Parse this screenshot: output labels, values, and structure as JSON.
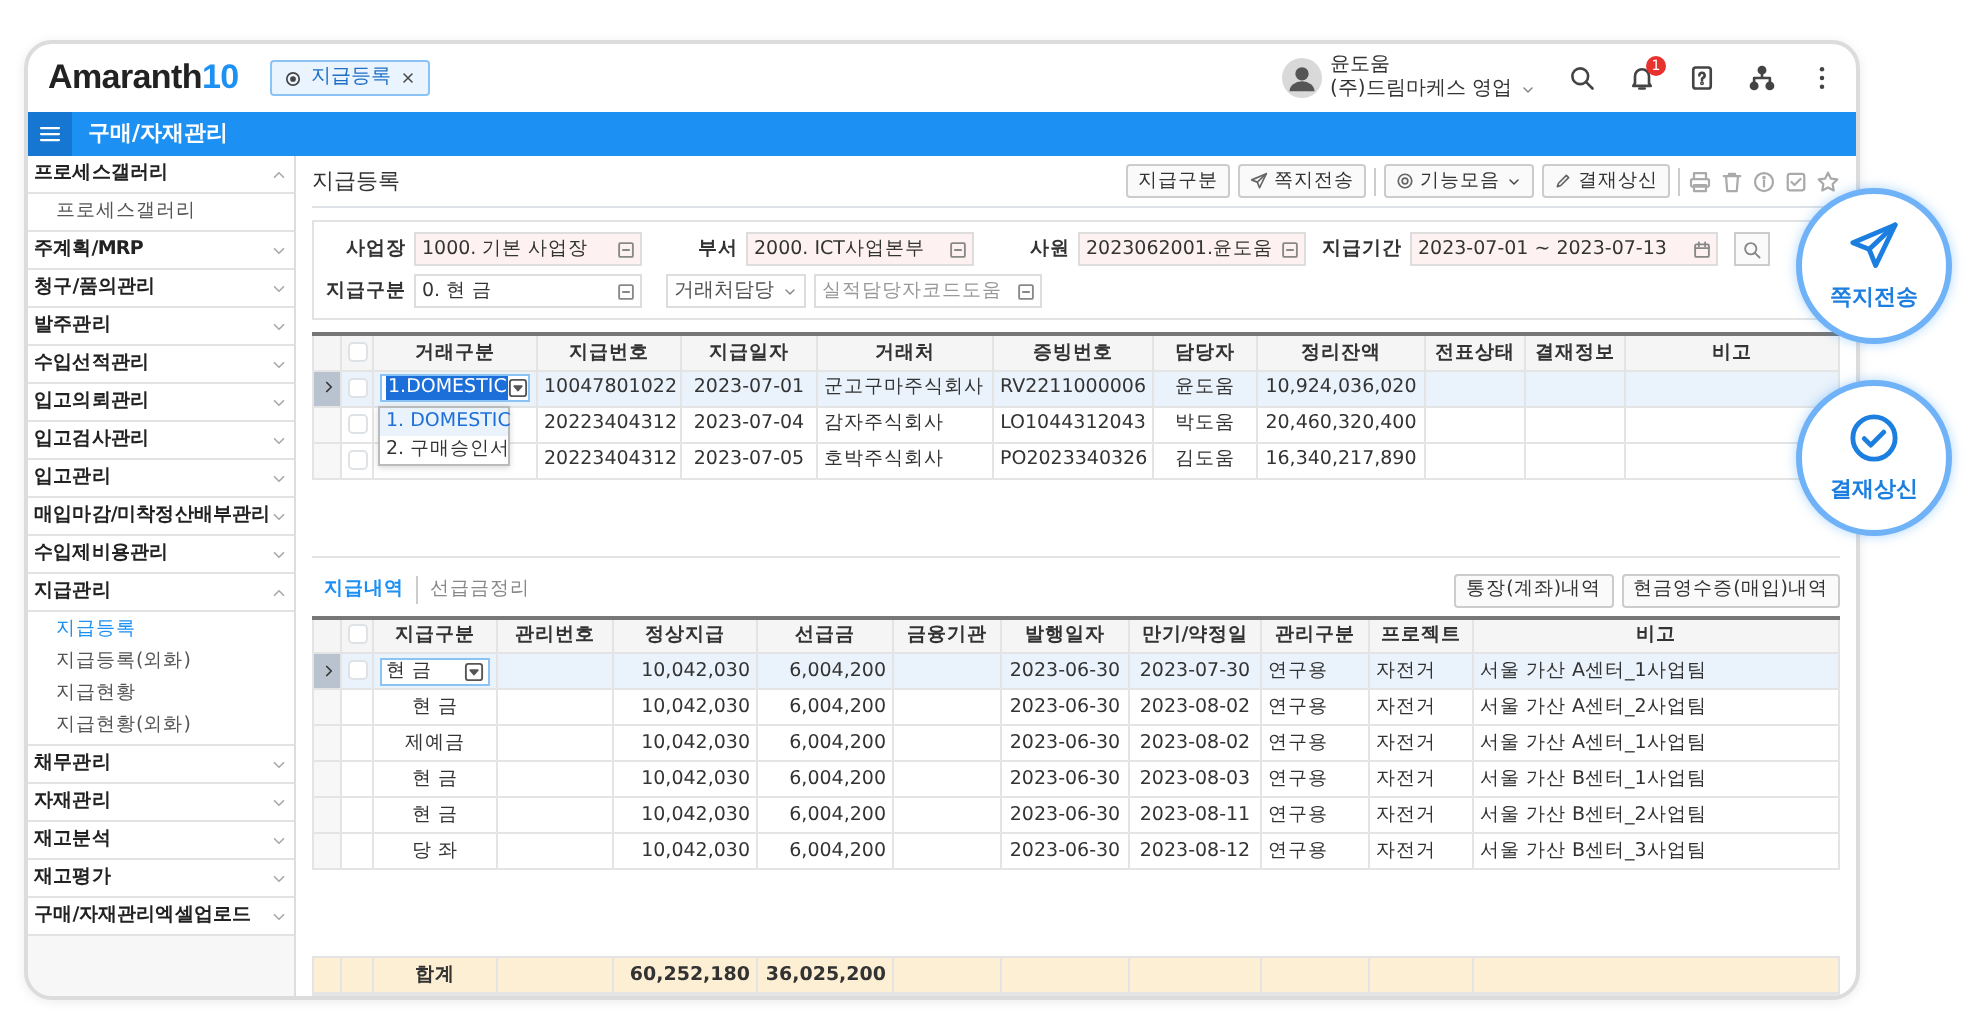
{
  "header": {
    "logo": {
      "text": "Amaranth",
      "accent": "10"
    },
    "tabs": [
      {
        "label": "지급등록",
        "selected": true
      }
    ],
    "user": {
      "name": "윤도움",
      "company": "(주)드림마케스 영업"
    },
    "notification_count": "1"
  },
  "menu_bar": {
    "title": "구매/자재관리"
  },
  "sidebar": {
    "items": [
      {
        "label": "프로세스갤러리",
        "expanded": true,
        "children": [
          {
            "label": "프로세스갤러리",
            "selected": false
          }
        ]
      },
      {
        "label": "주계획/MRP",
        "expanded": false
      },
      {
        "label": "청구/품의관리",
        "expanded": false
      },
      {
        "label": "발주관리",
        "expanded": false
      },
      {
        "label": "수입선적관리",
        "expanded": false
      },
      {
        "label": "입고의뢰관리",
        "expanded": false
      },
      {
        "label": "입고검사관리",
        "expanded": false
      },
      {
        "label": "입고관리",
        "expanded": false
      },
      {
        "label": "매입마감/미착정산배부관리",
        "expanded": false
      },
      {
        "label": "수입제비용관리",
        "expanded": false
      },
      {
        "label": "지급관리",
        "expanded": true,
        "children": [
          {
            "label": "지급등록",
            "selected": true
          },
          {
            "label": "지급등록(외화)",
            "selected": false
          },
          {
            "label": "지급현황",
            "selected": false
          },
          {
            "label": "지급현황(외화)",
            "selected": false
          }
        ]
      },
      {
        "label": "채무관리",
        "expanded": false
      },
      {
        "label": "자재관리",
        "expanded": false
      },
      {
        "label": "재고분석",
        "expanded": false
      },
      {
        "label": "재고평가",
        "expanded": false
      },
      {
        "label": "구매/자재관리엑셀업로드",
        "expanded": false
      }
    ]
  },
  "page": {
    "title": "지급등록",
    "toolbar": [
      {
        "label": "지급구분",
        "kind": "plain"
      },
      {
        "label": "쪽지전송",
        "kind": "message"
      },
      {
        "label": "기능모음",
        "kind": "menu"
      },
      {
        "label": "결재상신",
        "kind": "approve"
      }
    ]
  },
  "filters": [
    [
      {
        "label": "사업장",
        "value": "1000. 기본 사업장",
        "required": true,
        "kind": "code"
      },
      {
        "label": "부서",
        "value": "2000. ICT사업본부",
        "required": true,
        "kind": "code"
      },
      {
        "label": "사원",
        "value": "2023062001.윤도움",
        "required": true,
        "kind": "code"
      },
      {
        "label": "지급기간",
        "value": "2023-07-01 ~ 2023-07-13",
        "required": true,
        "kind": "date"
      }
    ],
    [
      {
        "label": "지급구분",
        "value": "0. 현 금",
        "required": false,
        "kind": "code"
      },
      {
        "value": "거래처담당",
        "kind": "select"
      },
      {
        "placeholder": "실적담당자코드도움",
        "required": false,
        "kind": "code"
      }
    ]
  ],
  "upper_grid": {
    "columns": [
      "거래구분",
      "지급번호",
      "지급일자",
      "거래처",
      "증빙번호",
      "담당자",
      "정리잔액",
      "전표상태",
      "결재정보",
      "비고"
    ],
    "select_all_checked": false,
    "rows": [
      {
        "selected": true,
        "checked": false,
        "editor": {
          "value": "1.DOMESTIC",
          "options": [
            {
              "label": "1. DOMESTIC",
              "selected": true
            },
            {
              "label": "2. 구매승인서",
              "selected": false
            }
          ]
        },
        "cells": [
          null,
          "10047801022",
          "2023-07-01",
          "군고구마주식회사",
          "RV2211000006",
          "윤도움",
          "10,924,036,020",
          null,
          null,
          null
        ]
      },
      {
        "selected": false,
        "checked": false,
        "cells": [
          null,
          "20223404312",
          "2023-07-04",
          "감자주식회사",
          "LO1044312043",
          "박도움",
          "20,460,320,400",
          null,
          null,
          null
        ]
      },
      {
        "selected": false,
        "checked": false,
        "cells": [
          null,
          "20223404312",
          "2023-07-05",
          "호박주식회사",
          "PO2023340326",
          "김도움",
          "16,340,217,890",
          null,
          null,
          null
        ]
      }
    ]
  },
  "lower_tabs": [
    {
      "label": "지급내역",
      "selected": true
    },
    {
      "label": "선급금정리",
      "selected": false
    }
  ],
  "lower_buttons": [
    "통장(계좌)내역",
    "현금영수증(매입)내역"
  ],
  "lower_grid": {
    "columns": [
      "지급구분",
      "관리번호",
      "정상지급",
      "선급금",
      "금융기관",
      "발행일자",
      "만기/약정일",
      "관리구분",
      "프로젝트",
      "비고"
    ],
    "select_all_checked": false,
    "rows": [
      {
        "selected": true,
        "checkbox": {
          "checked": false
        },
        "editor": {
          "value": "현 금"
        },
        "cells": [
          null,
          null,
          "10,042,030",
          "6,004,200",
          null,
          "2023-06-30",
          "2023-07-30",
          "연구용",
          "자전거",
          "서울 가산 A센터_1사업팀"
        ]
      },
      {
        "selected": false,
        "cells": [
          "현 금",
          null,
          "10,042,030",
          "6,004,200",
          null,
          "2023-06-30",
          "2023-08-02",
          "연구용",
          "자전거",
          "서울 가산 A센터_2사업팀"
        ]
      },
      {
        "selected": false,
        "cells": [
          "제예금",
          null,
          "10,042,030",
          "6,004,200",
          null,
          "2023-06-30",
          "2023-08-02",
          "연구용",
          "자전거",
          "서울 가산 A센터_1사업팀"
        ]
      },
      {
        "selected": false,
        "cells": [
          "현 금",
          null,
          "10,042,030",
          "6,004,200",
          null,
          "2023-06-30",
          "2023-08-03",
          "연구용",
          "자전거",
          "서울 가산 B센터_1사업팀"
        ]
      },
      {
        "selected": false,
        "cells": [
          "현 금",
          null,
          "10,042,030",
          "6,004,200",
          null,
          "2023-06-30",
          "2023-08-11",
          "연구용",
          "자전거",
          "서울 가산 B센터_2사업팀"
        ]
      },
      {
        "selected": false,
        "cells": [
          "당 좌",
          null,
          "10,042,030",
          "6,004,200",
          null,
          "2023-06-30",
          "2023-08-12",
          "연구용",
          "자전거",
          "서울 가산 B센터_3사업팀"
        ]
      }
    ],
    "total": {
      "label": "합계",
      "normal_payment": "60,252,180",
      "advance": "36,025,200"
    }
  },
  "floating_actions": [
    {
      "label": "쪽지전송",
      "kind": "send"
    },
    {
      "label": "결재상신",
      "kind": "approve"
    }
  ]
}
